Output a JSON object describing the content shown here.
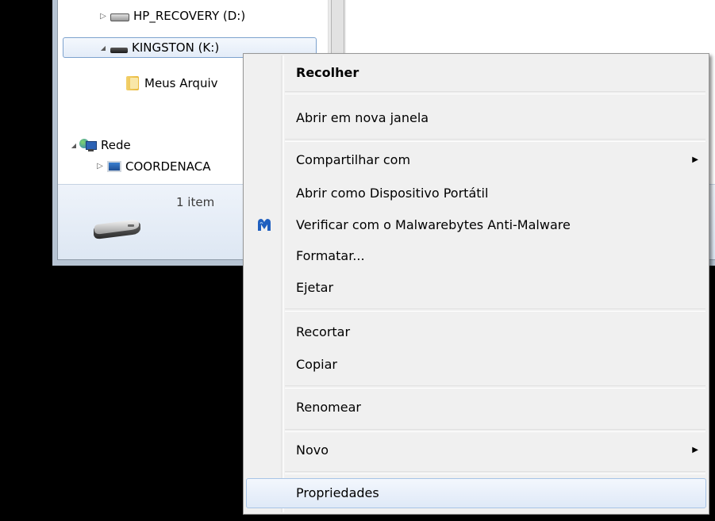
{
  "navigation_tree": {
    "items": [
      {
        "label": "HP_RECOVERY (D:)",
        "expander": "▷",
        "icon": "hard-drive-icon"
      },
      {
        "label": "KINGSTON (K:)",
        "expander": "◢",
        "icon": "usb-drive-icon",
        "selected": true
      },
      {
        "label": "Meus Arquiv",
        "icon": "folder-icon"
      },
      {
        "label": "Rede",
        "expander": "◢",
        "icon": "network-icon"
      },
      {
        "label": "COORDENACA",
        "expander": "▷",
        "icon": "computer-icon"
      }
    ]
  },
  "details_pane": {
    "item_count": "1 item",
    "icon": "removable-drive-icon"
  },
  "context_menu": {
    "items": [
      {
        "id": "collapse",
        "label": "Recolher",
        "bold": true
      },
      {
        "id": "open-new-window",
        "label": "Abrir em nova janela"
      },
      {
        "id": "share-with",
        "label": "Compartilhar com",
        "submenu_arrow": "▶"
      },
      {
        "id": "open-portable-device",
        "label": "Abrir como Dispositivo Portátil"
      },
      {
        "id": "scan-malwarebytes",
        "label": "Verificar com o Malwarebytes Anti-Malware",
        "icon": "malwarebytes-icon",
        "icon_color": "#1f5fbf"
      },
      {
        "id": "format",
        "label": "Formatar..."
      },
      {
        "id": "eject",
        "label": "Ejetar"
      },
      {
        "id": "cut",
        "label": "Recortar"
      },
      {
        "id": "copy",
        "label": "Copiar"
      },
      {
        "id": "rename",
        "label": "Renomear"
      },
      {
        "id": "new",
        "label": "Novo",
        "submenu_arrow": "▶"
      },
      {
        "id": "properties",
        "label": "Propriedades",
        "highlighted": true
      }
    ]
  }
}
